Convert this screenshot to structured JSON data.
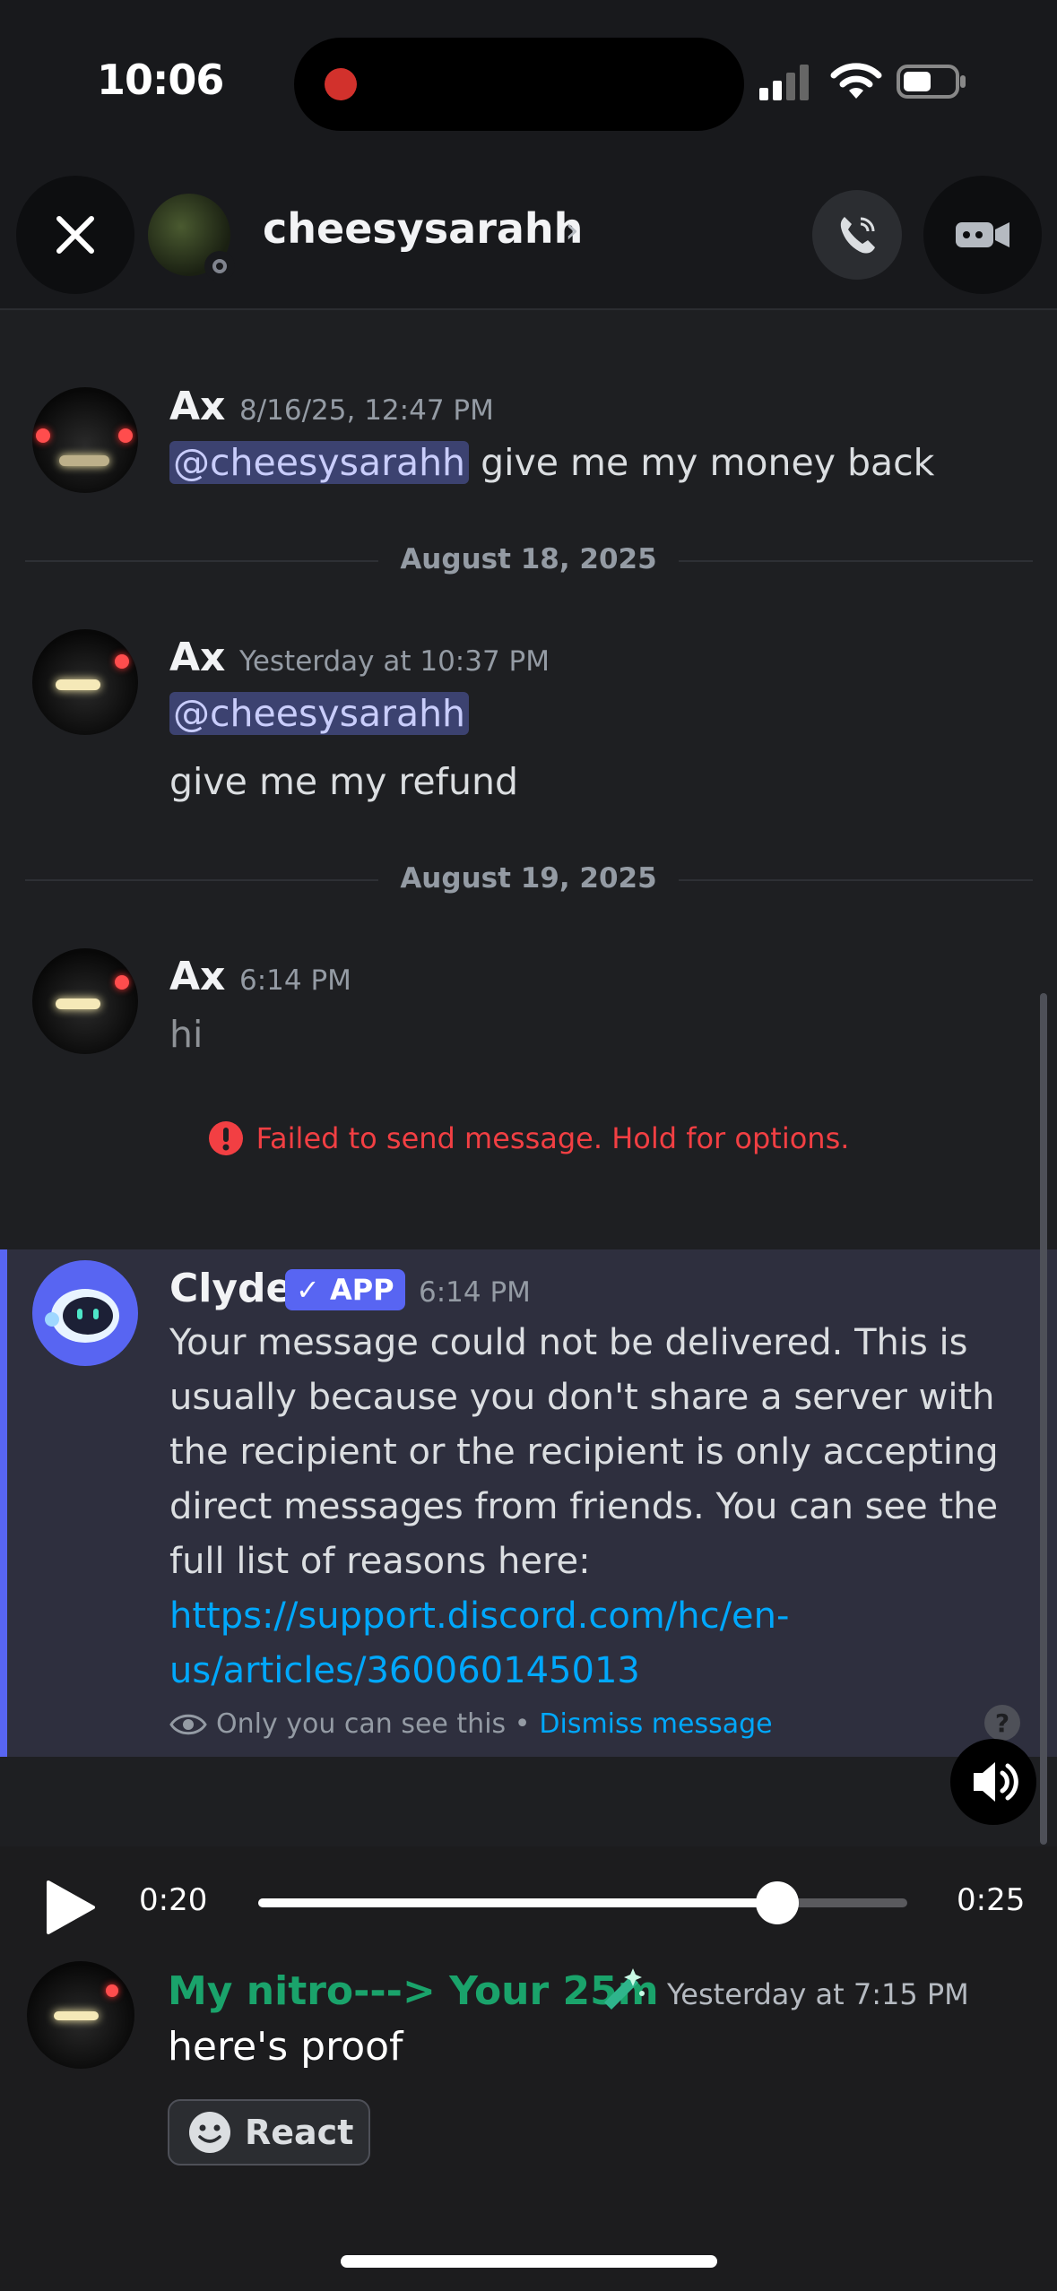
{
  "status_bar": {
    "time": "10:06"
  },
  "header": {
    "title": "cheesysarahh",
    "chevron": "›"
  },
  "messages": [
    {
      "author": "Ax",
      "timestamp": "8/16/25, 12:47 PM",
      "mention": "@cheesysarahh",
      "text": "give me my money back"
    },
    {
      "author": "Ax",
      "timestamp": "Yesterday at 10:37 PM",
      "mention": "@cheesysarahh",
      "text": "give me my refund"
    },
    {
      "author": "Ax",
      "timestamp": "6:14 PM",
      "text": "hi",
      "error": "Failed to send message. Hold for options."
    }
  ],
  "dividers": [
    "August 18, 2025",
    "August 19, 2025"
  ],
  "clyde": {
    "author": "Clyde",
    "badge": "✓ APP",
    "timestamp": "6:14 PM",
    "text": "Your message could not be delivered. This is usually because you don't share a server with the recipient or the recipient is only accepting direct messages from friends. You can see the full list of reasons here: ",
    "link": "https://support.discord.com/hc/en-us/articles/360060145013",
    "ephemeral_note": "Only you can see this •",
    "dismiss": "Dismiss message",
    "help": "?"
  },
  "player": {
    "current": "0:20",
    "total": "0:25",
    "progress": 0.8
  },
  "proof_message": {
    "author": "My nitro---> Your 25m",
    "timestamp": "Yesterday at 7:15 PM",
    "text": "here's proof",
    "react_label": "React"
  },
  "colors": {
    "accent": "#5865f2",
    "error": "#f23f43",
    "link": "#00a8fc",
    "role_green": "#1aa36b"
  }
}
